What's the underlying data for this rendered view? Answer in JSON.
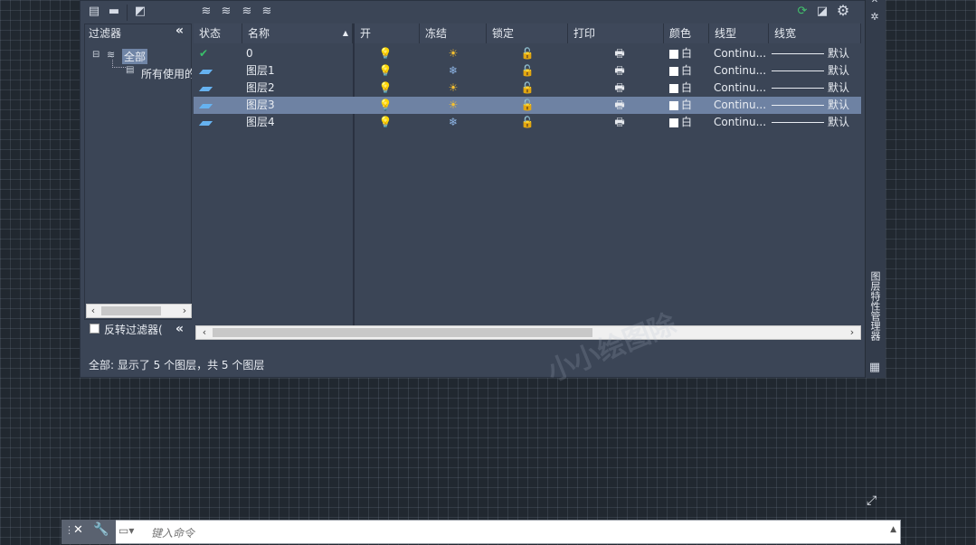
{
  "toolbar": {
    "left_icons": [
      "new-property-filter-icon",
      "new-group-filter-icon",
      "layer-states-manager-icon"
    ],
    "layer_icons": [
      "new-layer-icon",
      "new-layer-frozen-icon",
      "delete-layer-icon",
      "set-current-icon"
    ],
    "right_icons": [
      "refresh-icon",
      "settings-icon",
      "gear-icon"
    ]
  },
  "filter_pane": {
    "title": "过滤器",
    "collapse_glyph": "«",
    "tree": [
      {
        "label": "全部",
        "selected": true
      },
      {
        "label": "所有使用的"
      }
    ],
    "invert_label": "反转过滤器(",
    "invert_checked": false
  },
  "table": {
    "columns": [
      "状态",
      "名称",
      "开",
      "冻结",
      "锁定",
      "打印",
      "颜色",
      "线型",
      "线宽"
    ],
    "rows": [
      {
        "status": "current",
        "name": "0",
        "on": "bulb",
        "freeze": "sun",
        "lock": "unlock",
        "plot": "printer",
        "color": "白",
        "linetype": "Continu...",
        "lineweight": "默认",
        "selected": false
      },
      {
        "status": "layer",
        "name": "图层1",
        "on": "bulb",
        "freeze": "snow",
        "lock": "unlock",
        "plot": "printer",
        "color": "白",
        "linetype": "Continu...",
        "lineweight": "默认",
        "selected": false
      },
      {
        "status": "layer",
        "name": "图层2",
        "on": "bulb",
        "freeze": "sun",
        "lock": "unlock",
        "plot": "printer",
        "color": "白",
        "linetype": "Continu...",
        "lineweight": "默认",
        "selected": false
      },
      {
        "status": "layer",
        "name": "图层3",
        "on": "bulb",
        "freeze": "sun",
        "lock": "unlock",
        "plot": "printer",
        "color": "白",
        "linetype": "Continu...",
        "lineweight": "默认",
        "selected": true
      },
      {
        "status": "layer",
        "name": "图层4",
        "on": "bulb",
        "freeze": "snow",
        "lock": "unlock",
        "plot": "printer",
        "color": "白",
        "linetype": "Continu...",
        "lineweight": "默认",
        "selected": false
      }
    ]
  },
  "status_text": "全部: 显示了 5 个图层，共 5 个图层",
  "side_strip_title": "图层特性管理器",
  "command_line": {
    "placeholder": "键入命令"
  },
  "watermark": "小小绘图除"
}
